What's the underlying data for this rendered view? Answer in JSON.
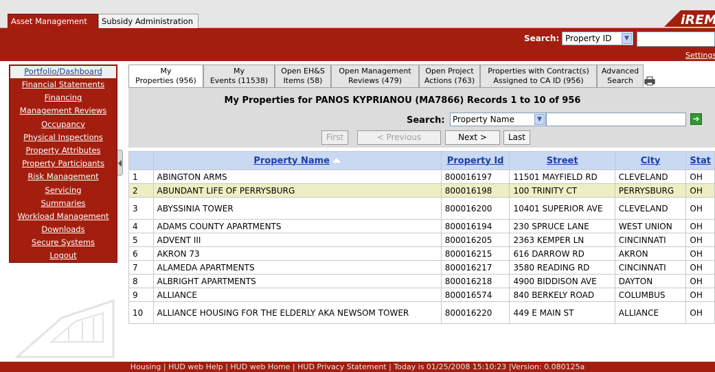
{
  "app_tabs": [
    "Asset Management",
    "Subsidy Administration"
  ],
  "header": {
    "search_label": "Search:",
    "search_select_value": "Property ID",
    "settings_link": "Settings",
    "logo_text": "iREMS"
  },
  "sidebar": {
    "items": [
      "Portfolio/Dashboard",
      "Financial Statements",
      "Financing",
      "Management Reviews",
      "Occupancy",
      "Physical Inspections",
      "Property Attributes",
      "Property Participants",
      "Risk Management",
      "Servicing",
      "Summaries",
      "Workload Management",
      "Downloads",
      "Secure Systems",
      "Logout"
    ]
  },
  "content_tabs": [
    {
      "line1": "My",
      "line2": "Properties (956)"
    },
    {
      "line1": "My",
      "line2": "Events (11538)"
    },
    {
      "line1": "Open EH&S",
      "line2": "Items (58)"
    },
    {
      "line1": "Open Management",
      "line2": "Reviews (479)"
    },
    {
      "line1": "Open Project",
      "line2": "Actions (763)"
    },
    {
      "line1": "Properties with Contract(s)",
      "line2": "Assigned to CA ID (956)"
    },
    {
      "line1": "Advanced",
      "line2": "Search"
    }
  ],
  "panel": {
    "title": "My Properties for PANOS KYPRIANOU (MA7866) Records 1 to 10 of 956",
    "search_label": "Search:",
    "search_select_value": "Property Name",
    "go_label": "➔"
  },
  "pagination": {
    "first": "First",
    "previous": "< Previous",
    "next": "Next >",
    "last": "Last"
  },
  "table": {
    "headers": [
      "Property Name",
      "Property Id",
      "Street",
      "City",
      "Stat"
    ],
    "rows": [
      {
        "num": "1",
        "name": "ABINGTON ARMS",
        "id": "800016197",
        "street": "11501 MAYFIELD RD",
        "city": "CLEVELAND",
        "state": "OH"
      },
      {
        "num": "2",
        "name": "ABUNDANT LIFE OF PERRYSBURG",
        "id": "800016198",
        "street": "100 TRINITY CT",
        "city": "PERRYSBURG",
        "state": "OH"
      },
      {
        "num": "3",
        "name": "ABYSSINIA TOWER",
        "id": "800016200",
        "street": "10401 SUPERIOR AVE",
        "city": "CLEVELAND",
        "state": "OH"
      },
      {
        "num": "4",
        "name": "ADAMS COUNTY APARTMENTS",
        "id": "800016194",
        "street": "230 SPRUCE LANE",
        "city": "WEST UNION",
        "state": "OH"
      },
      {
        "num": "5",
        "name": "ADVENT III",
        "id": "800016205",
        "street": "2363 KEMPER LN",
        "city": "CINCINNATI",
        "state": "OH"
      },
      {
        "num": "6",
        "name": "AKRON 73",
        "id": "800016215",
        "street": "616 DARROW RD",
        "city": "AKRON",
        "state": "OH"
      },
      {
        "num": "7",
        "name": "ALAMEDA APARTMENTS",
        "id": "800016217",
        "street": "3580 READING RD",
        "city": "CINCINNATI",
        "state": "OH"
      },
      {
        "num": "8",
        "name": "ALBRIGHT APARTMENTS",
        "id": "800016218",
        "street": "4900 BIDDISON AVE",
        "city": "DAYTON",
        "state": "OH"
      },
      {
        "num": "9",
        "name": "ALLIANCE",
        "id": "800016574",
        "street": "840 BERKELY ROAD",
        "city": "COLUMBUS",
        "state": "OH"
      },
      {
        "num": "10",
        "name": "ALLIANCE HOUSING FOR THE ELDERLY AKA NEWSOM TOWER",
        "id": "800016220",
        "street": "449 E MAIN ST",
        "city": "ALLIANCE",
        "state": "OH"
      }
    ]
  },
  "footer": "Housing | HUD web Help | HUD web Home | HUD Privacy Statement | Today is 01/25/2008 15:10:23 |Version: 0.080125a",
  "colors": {
    "brand_red": "#a31e0e",
    "header_blue": "#c9d9f2",
    "row_highlight": "#eeeec4"
  }
}
